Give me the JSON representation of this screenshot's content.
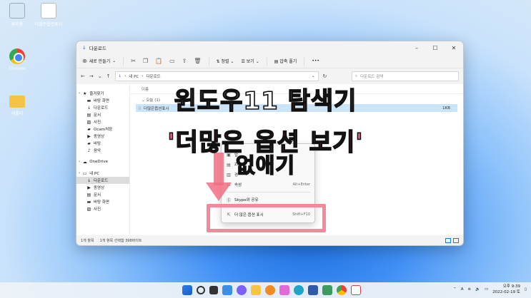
{
  "desktop": {
    "icons": [
      "휴지통",
      "더많은옵션표시",
      "Chrome",
      "새폴더"
    ]
  },
  "window": {
    "title": "다운로드",
    "new_label": "새로 만들기",
    "sort_label": "정렬",
    "view_label": "보기",
    "extract_label": "압축 풀기",
    "more_label": "•••",
    "path": [
      "내 PC",
      "다운로드"
    ],
    "search_placeholder": "다운로드 검색"
  },
  "nav": [
    {
      "label": "즐겨찾기",
      "icon": "star-icon",
      "level": "top"
    },
    {
      "label": "바탕 화면",
      "icon": "desktop-icon"
    },
    {
      "label": "다운로드",
      "icon": "download-icon"
    },
    {
      "label": "문서",
      "icon": "document-icon"
    },
    {
      "label": "사진",
      "icon": "picture-icon"
    },
    {
      "label": "Ocam처장",
      "icon": "folder-icon"
    },
    {
      "label": "동영상",
      "icon": "video-icon"
    },
    {
      "label": "바탕",
      "icon": "folder-icon"
    },
    {
      "label": "음악",
      "icon": "music-icon"
    },
    {
      "label": "OneDrive",
      "icon": "cloud-icon",
      "level": "top"
    },
    {
      "label": "내 PC",
      "icon": "pc-icon",
      "level": "top"
    },
    {
      "label": "다운로드",
      "icon": "download-icon",
      "selected": true
    },
    {
      "label": "동영상",
      "icon": "video-icon"
    },
    {
      "label": "문서",
      "icon": "document-icon"
    },
    {
      "label": "바탕 화면",
      "icon": "desktop-icon"
    },
    {
      "label": "사진",
      "icon": "picture-icon"
    }
  ],
  "content": {
    "column_name": "이름",
    "group_label": "오늘 (1)",
    "file_name": "더많은옵션표시",
    "file_size": "1KB"
  },
  "context_menu": {
    "items": [
      {
        "label": "압",
        "icon": "archive-icon",
        "shortcut": ""
      },
      {
        "label": "ZIP",
        "icon": "zip-icon",
        "shortcut": ""
      },
      {
        "label": "경",
        "icon": "copy-path-icon",
        "shortcut": ""
      },
      {
        "label": "속성",
        "icon": "properties-icon",
        "shortcut": "Alt+Enter"
      },
      {
        "label": "Skype와 공유",
        "icon": "skype-icon",
        "shortcut": ""
      },
      {
        "label": "더 많은 옵션 표시",
        "icon": "more-options-icon",
        "shortcut": "Shift+F10"
      }
    ]
  },
  "status": {
    "count": "1개 항목",
    "selected": "1개 항목 선택함 398바이트"
  },
  "headline": {
    "line1": "윈도우11 탐색기",
    "line2": "'더많은 옵션 보기'",
    "line3": "없애기"
  },
  "tray": {
    "ime": "A",
    "time": "오후 9:39",
    "date": "2022-02-19 토"
  },
  "colors": {
    "accent": "#1a73e8",
    "highlight_box": "#f48296",
    "selection": "#cce4f7"
  }
}
